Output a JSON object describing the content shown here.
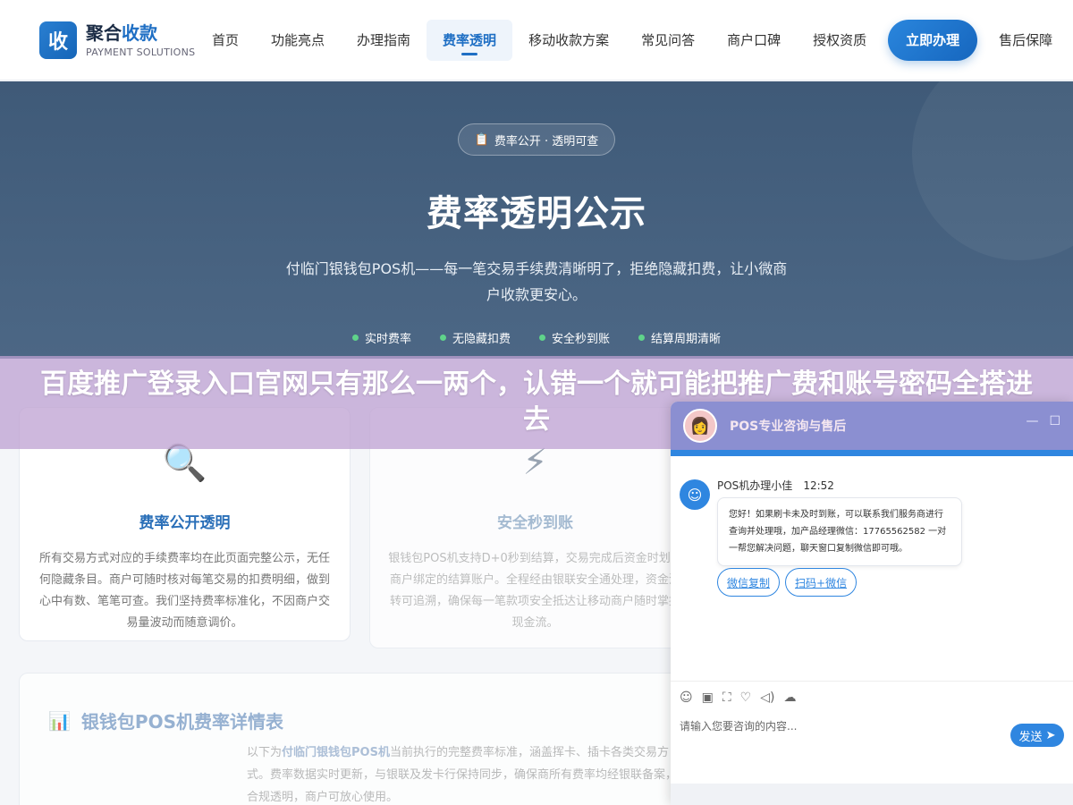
{
  "header": {
    "logo_mark": "收",
    "logo_title_a": "聚合",
    "logo_title_b": "收款",
    "logo_sub": "PAYMENT SOLUTIONS",
    "nav": [
      "首页",
      "功能亮点",
      "办理指南",
      "费率透明",
      "移动收款方案",
      "常见问答",
      "商户口碑",
      "授权资质"
    ],
    "active_index": 3,
    "cta": "立即办理",
    "after_cta": "售后保障"
  },
  "hero": {
    "pill": "费率公开 · 透明可查",
    "pill_icon": "clipboard-icon",
    "title": "费率透明公示",
    "desc": "付临门银钱包POS机——每一笔交易手续费清晰明了，拒绝隐藏扣费，让小微商户收款更安心。",
    "tags": [
      "实时费率",
      "无隐藏扣费",
      "安全秒到账",
      "结算周期清晰"
    ]
  },
  "banner": {
    "text": "百度推广登录入口官网只有那么一两个，认错一个就可能把推广费和账号密码全搭进去"
  },
  "cards": [
    {
      "icon": "magnifier-icon",
      "glyph": "🔍",
      "title": "费率公开透明",
      "text": "所有交易方式对应的手续费率均在此页面完整公示，无任何隐藏条目。商户可随时核对每笔交易的扣费明细，做到心中有数、笔笔可查。我们坚持费率标准化，不因商户交易量波动而随意调价。"
    },
    {
      "icon": "lightning-icon",
      "glyph": "⚡",
      "title": "安全秒到账",
      "text": "银钱包POS机支持D+0秒到结算，交易完成后资金时划入商户绑定的结算账户。全程经由银联安全通处理，资金流转可追溯，确保每一笔款项安全抵达让移动商户随时掌握现金流。"
    }
  ],
  "table": {
    "icon": "bar-chart-icon",
    "glyph": "📊",
    "title": "银钱包POS机费率详情表",
    "desc_a": "以下为",
    "desc_b": "付临门银钱包POS机",
    "desc_c": "当前执行的完整费率标准，涵盖挥卡、插卡各类交易方式。费率数据实时更新，与银联及发卡行保持同步，确保商所有费率均经银联备案，合规透明，商户可放心使用。"
  },
  "chat": {
    "title": "POS专业咨询与售后",
    "min": "—",
    "max": "☐",
    "agent": "POS机办理小佳",
    "time": "12:52",
    "message": "您好！如果刷卡未及时到账，可以联系我们服务商进行查询并处理哦，加产品经理微信：17765562582 一对一帮您解决问题，聊天窗口复制微信即可哦。",
    "buttons": [
      "微信复制",
      "扫码+微信"
    ],
    "toolbar_icons": [
      "☺",
      "▣",
      "⛶",
      "♡",
      "◁)",
      "☁"
    ],
    "placeholder": "请输入您要咨询的内容...",
    "send": "发送"
  }
}
